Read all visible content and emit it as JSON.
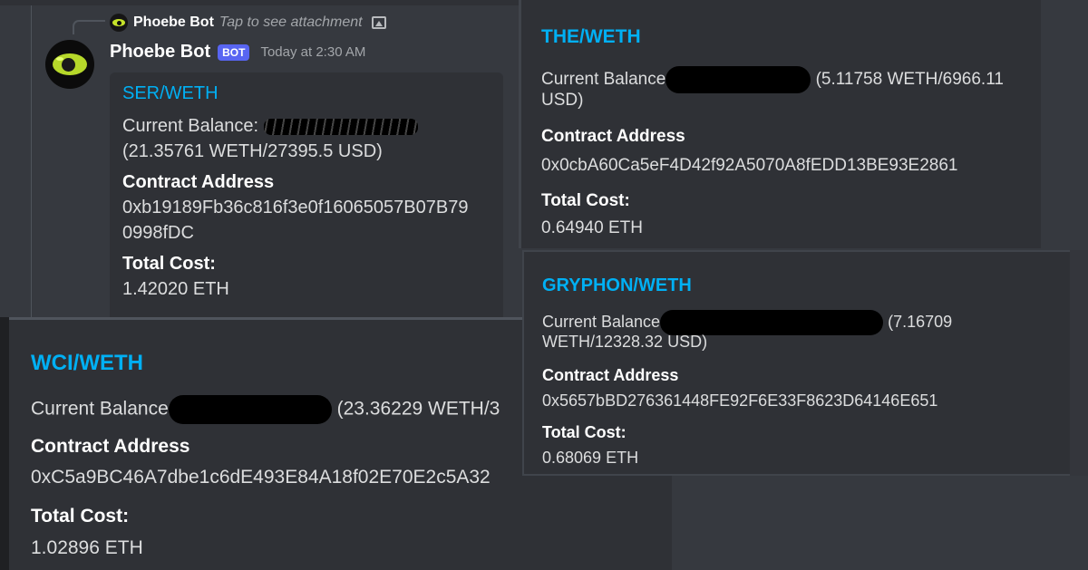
{
  "reply": {
    "name": "Phoebe Bot",
    "text": "Tap to see attachment"
  },
  "message": {
    "author": "Phoebe Bot",
    "tag": "BOT",
    "timestamp": "Today at 2:30 AM"
  },
  "cards": {
    "ser": {
      "pair": "SER/WETH",
      "balance_prefix": "Current Balance:",
      "balance_value": "(21.35761 WETH/27395.5 USD)",
      "contract_label": "Contract Address",
      "contract_line1": "0xb19189Fb36c816f3e0f16065057B07B79",
      "contract_line2": "0998fDC",
      "cost_label": "Total Cost:",
      "cost_value": "1.42020 ETH"
    },
    "the": {
      "pair": "THE/WETH",
      "balance_prefix": "Current Balance",
      "balance_value_1": "(5.11758 WETH/6966.11",
      "balance_value_2": "USD)",
      "contract_label": "Contract Address",
      "contract_value": "0x0cbA60Ca5eF4D42f92A5070A8fEDD13BE93E2861",
      "cost_label": "Total Cost:",
      "cost_value": "0.64940 ETH"
    },
    "gryphon": {
      "pair": "GRYPHON/WETH",
      "balance_prefix": "Current Balance",
      "balance_value_1": "(7.16709",
      "balance_value_2": "WETH/12328.32 USD)",
      "contract_label": "Contract Address",
      "contract_value": "0x5657bBD276361448FE92F6E33F8623D64146E651",
      "cost_label": "Total Cost:",
      "cost_value": "0.68069 ETH"
    },
    "wci": {
      "pair": "WCI/WETH",
      "balance_prefix": "Current Balance",
      "balance_value": "(23.36229 WETH/3",
      "contract_label": "Contract Address",
      "contract_value": "0xC5a9BC46A7dbe1c6dE493E84A18f02E70E2c5A32",
      "cost_label": "Total Cost:",
      "cost_value": "1.02896 ETH"
    }
  },
  "colors": {
    "background": "#36393f",
    "embed": "#2f3136",
    "link_blue": "#00b0f4",
    "bot_tag": "#5865f2"
  }
}
